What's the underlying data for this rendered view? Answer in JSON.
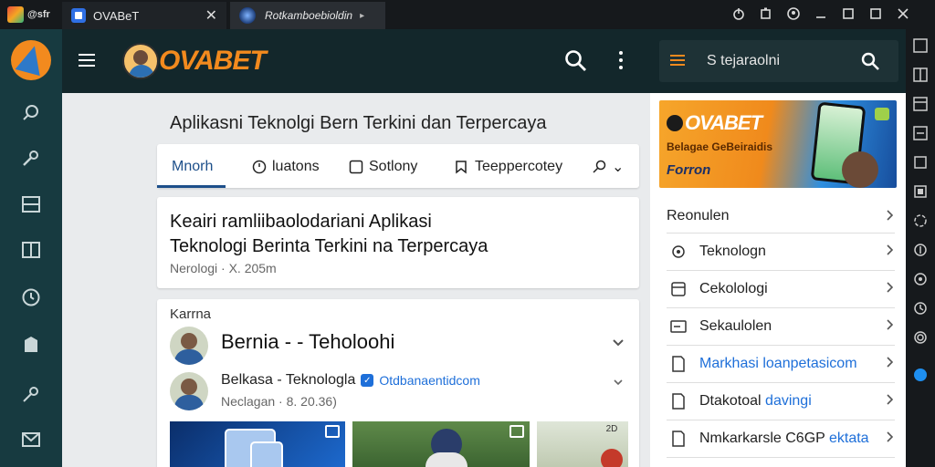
{
  "window": {
    "app_badge": "@sfr",
    "tabs": [
      {
        "label": "OVABeT",
        "icon": "browser-tab-icon"
      },
      {
        "label": "Rotkamboebioldin",
        "icon": "globe-icon"
      }
    ],
    "tab_close": "✕",
    "tab_arrow": "▸"
  },
  "header": {
    "brand": "OVABET",
    "icons": [
      "menu-icon",
      "search-icon",
      "more-icon"
    ]
  },
  "main": {
    "title": "Aplikasni Teknolgi Bern Terkini dan Terpercaya",
    "filters": [
      {
        "label": "Mnorh",
        "active": true
      },
      {
        "label": "luatons",
        "icon": "clock-icon"
      },
      {
        "label": "Sotlony",
        "icon": "box-icon"
      },
      {
        "label": "Teeppercotey",
        "icon": "tag-icon"
      }
    ],
    "filter_more": "⌄",
    "headline_card": {
      "line1": "Keairi ramliibaolodariani Aplikasi",
      "line2": "Teknologi Berinta Terkini na Terpercaya",
      "meta": "Nerologi · X. 205m"
    },
    "post_card": {
      "category": "Karrna",
      "group_name": "Bernia - - Teholoohi",
      "author": "Belkasa - Teknologla",
      "handle": "Otdbanaentidcom",
      "date": "Neclagan · 8. 20.36)",
      "thumb_badges": [
        "",
        "",
        "2D"
      ]
    }
  },
  "right_panel": {
    "search_text": "S tejaraolni",
    "banner": {
      "brand": "OVABET",
      "subtitle": "Belagae GeBeiraidis",
      "footer": "Forron"
    },
    "list": [
      {
        "label": "Reonulen"
      },
      {
        "label": "Teknologn",
        "icon": "gear-icon"
      },
      {
        "label": "Cekolologi",
        "icon": "box-icon"
      },
      {
        "label": "Sekaulolen",
        "icon": "card-icon"
      },
      {
        "label": "Markhasi loanpetasicom",
        "icon": "doc-icon",
        "blue": true
      },
      {
        "label": "Dtakotoal",
        "accent": "davingi",
        "icon": "doc-icon"
      },
      {
        "label": "Nmkarkarsle C6GP",
        "accent": "ektata",
        "icon": "doc-icon"
      }
    ]
  },
  "colors": {
    "brand_orange": "#f28a1e",
    "link_blue": "#1e6fd9",
    "header_dark": "#13272b",
    "rail_teal": "#173a40"
  }
}
